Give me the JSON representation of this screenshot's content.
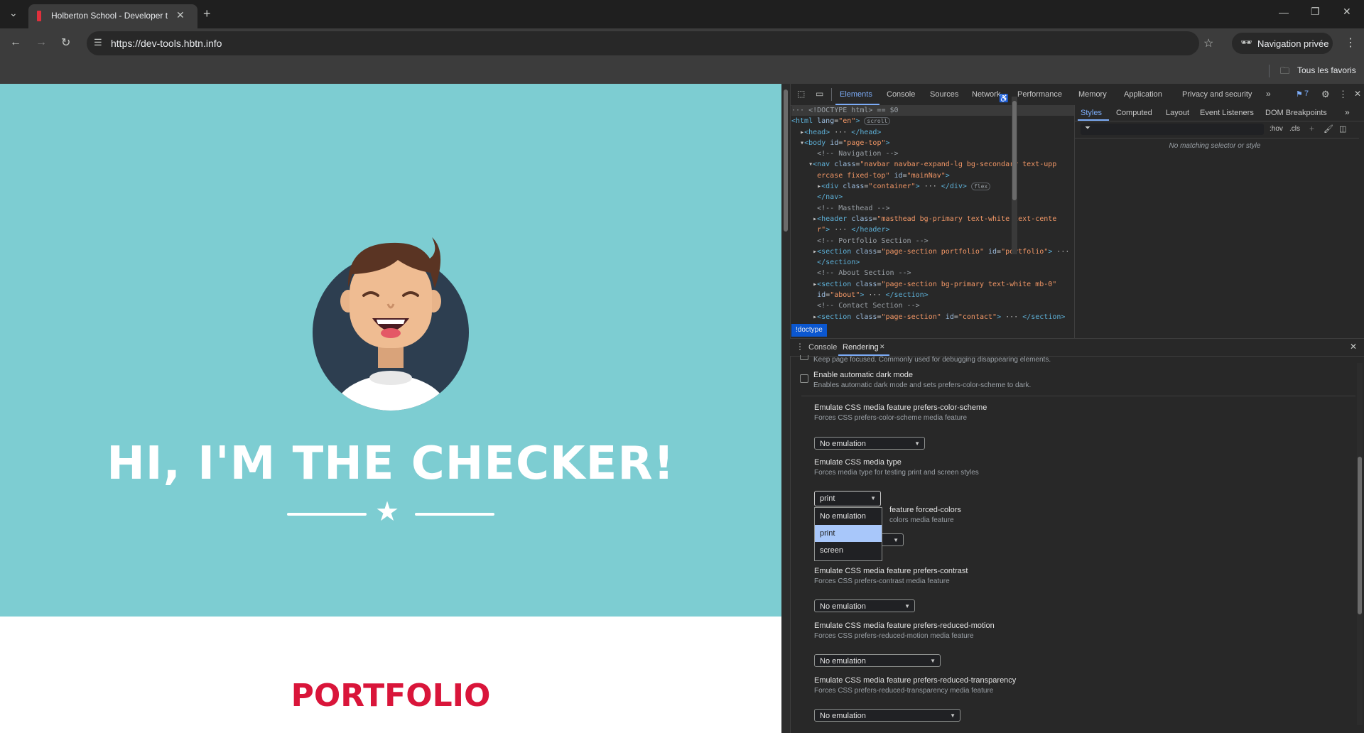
{
  "browser": {
    "tab_title": "Holberton School - Developer t",
    "url": "https://dev-tools.hbtn.info",
    "incognito_label": "Navigation privée",
    "bookmarks_label": "Tous les favoris"
  },
  "page": {
    "hero_title": "HI, I'M THE CHECKER!",
    "section_title": "PORTFOLIO",
    "colors": {
      "masthead": "#7dcdd2",
      "accent": "#d9153a"
    }
  },
  "devtools": {
    "tabs": [
      "Elements",
      "Console",
      "Sources",
      "Network",
      "Performance",
      "Memory",
      "Application",
      "Privacy and security"
    ],
    "issues_count": "7",
    "elements": {
      "doctype_line": "<!DOCTYPE html> == $0",
      "breadcrumb": "!doctype"
    },
    "styles": {
      "tabs": [
        "Styles",
        "Computed",
        "Layout",
        "Event Listeners",
        "DOM Breakpoints"
      ],
      "hov": ":hov",
      "cls": ".cls",
      "empty": "No matching selector or style"
    },
    "drawer": {
      "tabs": [
        "Console",
        "Rendering"
      ]
    },
    "rendering": {
      "partial_desc": "Keep page focused. Commonly used for debugging disappearing elements.",
      "dark_mode_title": "Enable automatic dark mode",
      "dark_mode_desc": "Enables automatic dark mode and sets prefers-color-scheme to dark.",
      "color_scheme": {
        "title": "Emulate CSS media feature prefers-color-scheme",
        "desc": "Forces CSS prefers-color-scheme media feature",
        "value": "No emulation"
      },
      "media_type": {
        "title": "Emulate CSS media type",
        "desc": "Forces media type for testing print and screen styles",
        "value": "print",
        "options": [
          "No emulation",
          "print",
          "screen"
        ]
      },
      "forced_colors": {
        "title_partial": "feature forced-colors",
        "desc_partial": "colors media feature"
      },
      "contrast": {
        "title": "Emulate CSS media feature prefers-contrast",
        "desc": "Forces CSS prefers-contrast media feature",
        "value": "No emulation"
      },
      "reduced_motion": {
        "title": "Emulate CSS media feature prefers-reduced-motion",
        "desc": "Forces CSS prefers-reduced-motion media feature",
        "value": "No emulation"
      },
      "reduced_transparency": {
        "title": "Emulate CSS media feature prefers-reduced-transparency",
        "desc": "Forces CSS prefers-reduced-transparency media feature",
        "value": "No emulation"
      }
    }
  }
}
